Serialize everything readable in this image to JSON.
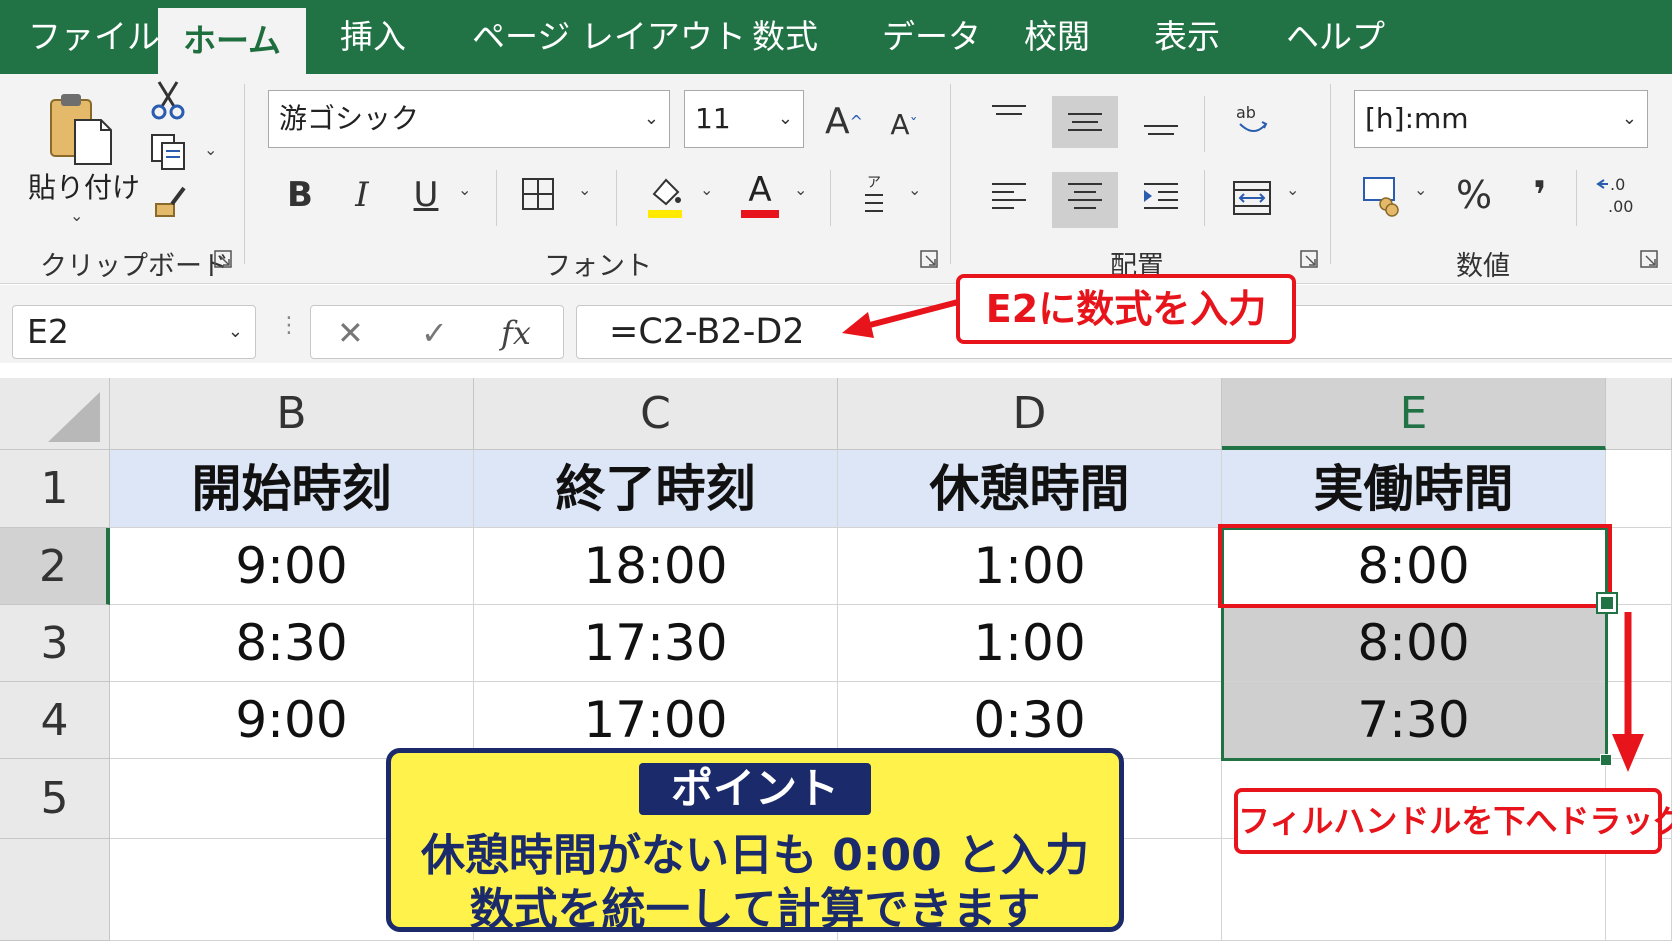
{
  "tabs": [
    "ファイル",
    "ホーム",
    "挿入",
    "ページ レイアウト",
    "数式",
    "データ",
    "校閲",
    "表示",
    "ヘルプ"
  ],
  "active_tab": "ホーム",
  "ribbon": {
    "clipboard": {
      "paste_label": "貼り付け",
      "group_label": "クリップボード"
    },
    "font": {
      "font_name": "游ゴシック",
      "font_size": "11",
      "grow": "A",
      "shrink": "A",
      "bold": "B",
      "italic": "I",
      "underline": "U",
      "font_color_letter": "A",
      "group_label": "フォント"
    },
    "alignment": {
      "group_label": "配置"
    },
    "number": {
      "format": "[h]:mm",
      "percent": "%",
      "comma": "❜",
      "group_label": "数値"
    }
  },
  "formula_bar": {
    "name_box": "E2",
    "cancel": "✕",
    "enter": "✓",
    "fx": "fx",
    "formula": "=C2-B2-D2"
  },
  "sheet": {
    "columns": [
      "B",
      "C",
      "D",
      "E"
    ],
    "selected_column": "E",
    "rows": [
      "1",
      "2",
      "3",
      "4",
      "5"
    ],
    "selected_row": "2",
    "header": [
      "開始時刻",
      "終了時刻",
      "休憩時間",
      "実働時間"
    ],
    "data": [
      [
        "9:00",
        "18:00",
        "1:00",
        "8:00"
      ],
      [
        "8:30",
        "17:30",
        "1:00",
        "8:00"
      ],
      [
        "9:00",
        "17:00",
        "0:30",
        "7:30"
      ]
    ]
  },
  "annotations": {
    "formula_callout": "E2に数式を入力",
    "fill_callout": "フィルハンドルを下へドラッグ",
    "point_title": "ポイント",
    "point_line1": "休憩時間がない日も 0:00 と入力",
    "point_line2": "数式を統一して計算できます"
  },
  "colors": {
    "tab_green": "#217346",
    "header_fill": "#dde6f6",
    "callout_red": "#e8141b",
    "point_yellow": "#fff24a",
    "point_navy": "#1a2a6b"
  }
}
